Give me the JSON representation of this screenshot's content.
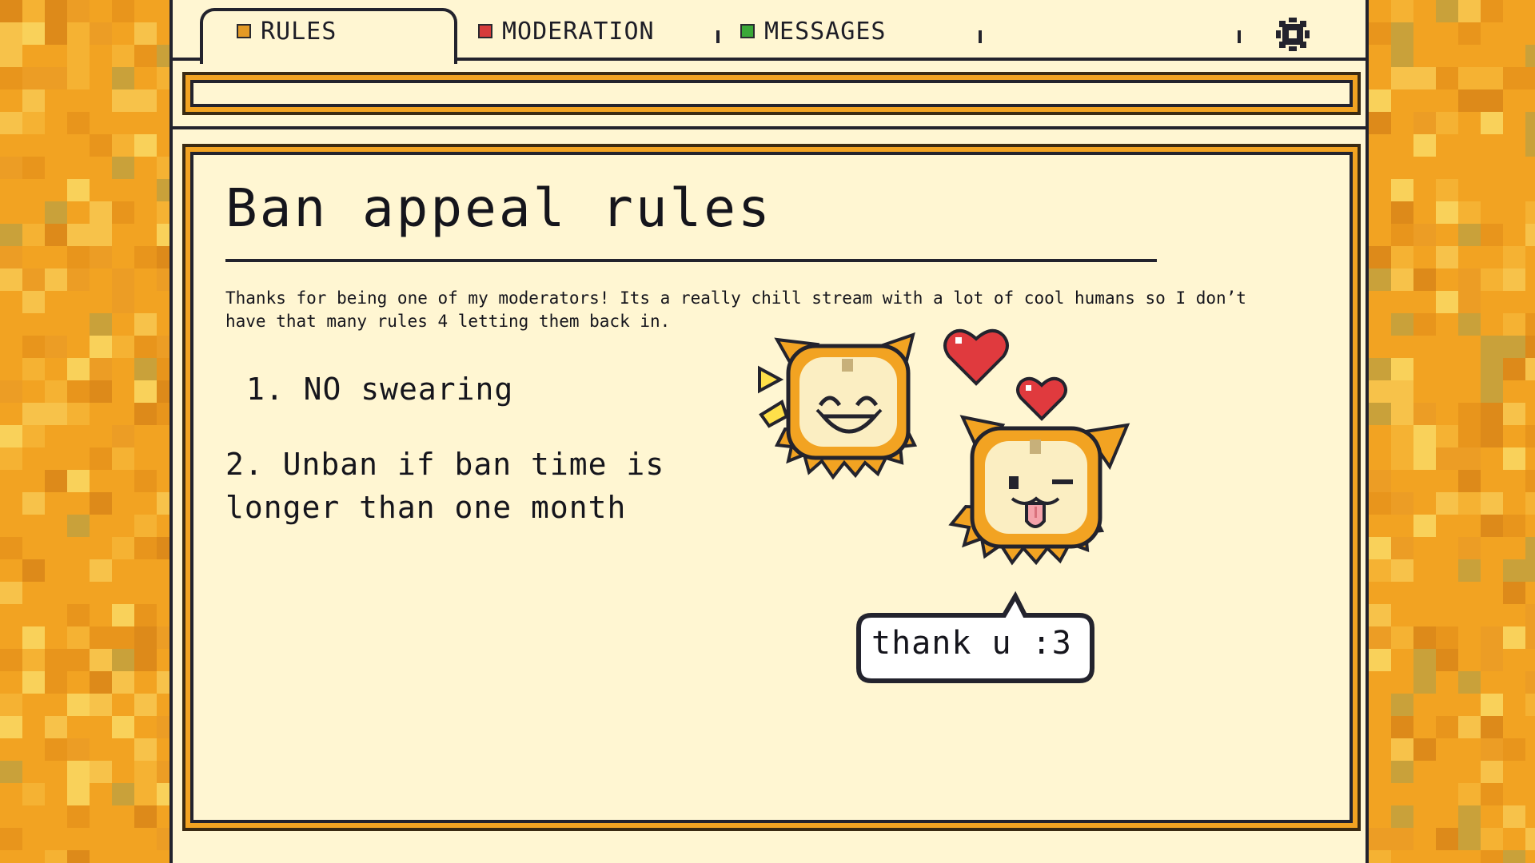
{
  "tabs": [
    {
      "label": "RULES",
      "color": "#e39a25",
      "active": true
    },
    {
      "label": "MODERATION",
      "color": "#d63b3b",
      "active": false
    },
    {
      "label": "MESSAGES",
      "color": "#3aa838",
      "active": false
    }
  ],
  "settings_icon": "gear-icon",
  "page": {
    "title": "Ban appeal rules",
    "intro": "Thanks for being one of my moderators! Its a really chill stream with a lot of cool humans so I don’t have that many rules 4 letting them back in.",
    "rules": [
      "1. NO swearing",
      "2. Unban if ban time is longer than one month"
    ]
  },
  "speech_bubble": "thank u :3",
  "colors": {
    "background": "#f2a322",
    "window": "#fff6d2",
    "outline": "#23232d",
    "heart": "#e03a3e"
  }
}
